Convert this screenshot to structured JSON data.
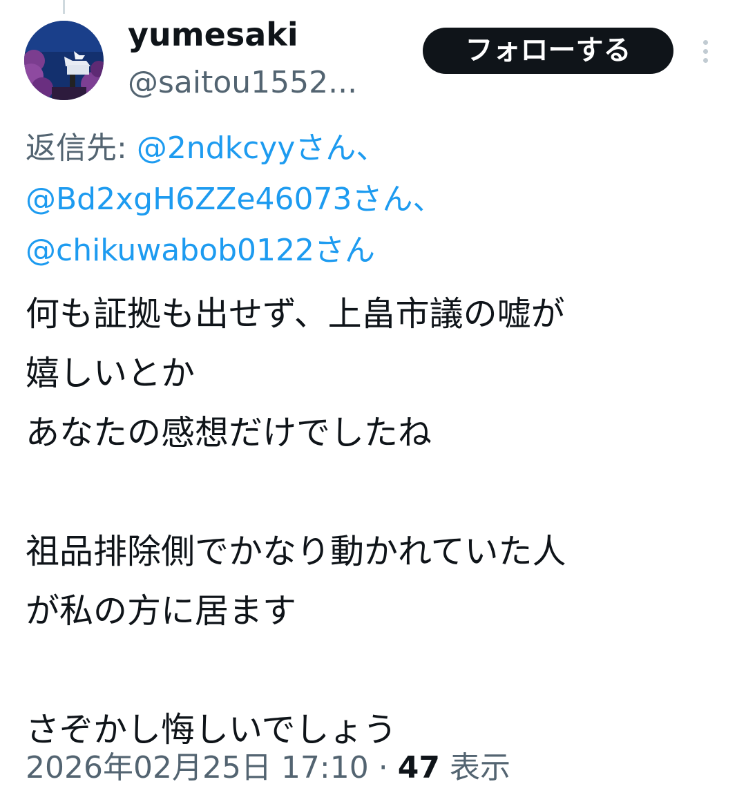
{
  "author": {
    "display_name": "yumesaki",
    "handle": "@saitou1552..."
  },
  "actions": {
    "follow_label": "フォローする",
    "more_icon": "more-vertical-icon"
  },
  "reply_to": {
    "prefix": "返信先: ",
    "mentions": [
      "@2ndkcyyさん、",
      "@Bd2xgH6ZZe46073さん、",
      "@chikuwabob0122さん"
    ]
  },
  "tweet": {
    "lines": [
      "何も証拠も出せず、上畠市議の嘘が",
      "嬉しいとか",
      "あなたの感想だけでしたね",
      "",
      "祖品排除側でかなり動かれていた人",
      "が私の方に居ます",
      "",
      "さぞかし悔しいでしょう"
    ]
  },
  "meta": {
    "timestamp": "2026年02月25日 17:10",
    "separator": " · ",
    "views_count": "47",
    "views_label": " 表示"
  },
  "colors": {
    "text": "#0f1419",
    "secondary": "#536471",
    "link": "#1d9bf0",
    "button_bg": "#0f1419",
    "button_text": "#ffffff"
  }
}
